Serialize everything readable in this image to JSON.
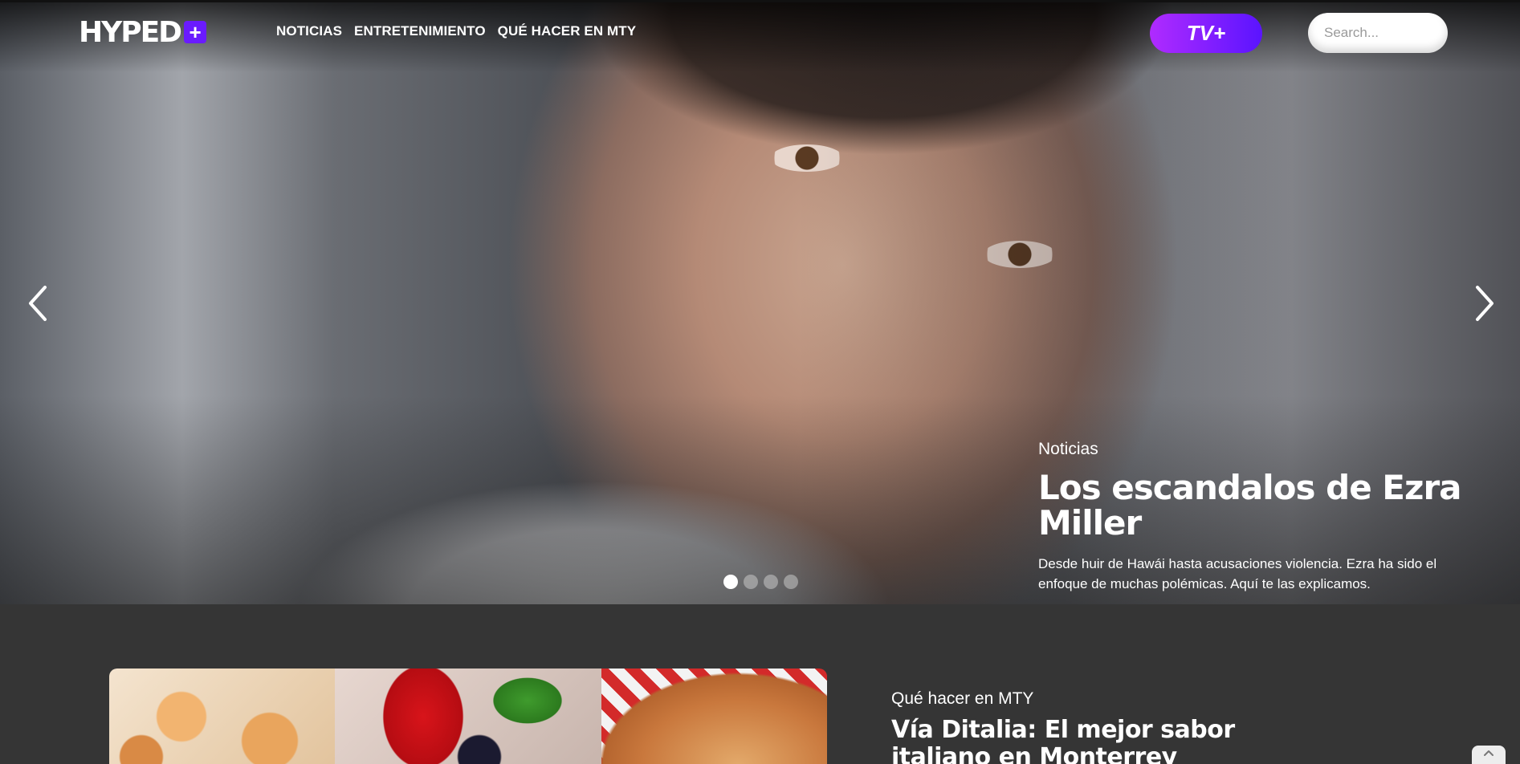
{
  "header": {
    "logo_text": "HYPED",
    "logo_plus": "+",
    "nav": [
      {
        "label": "NOTICIAS"
      },
      {
        "label": "ENTRETENIMIENTO"
      },
      {
        "label": "QUÉ HACER EN MTY"
      }
    ],
    "tv_button_label": "TV+",
    "search_placeholder": "Search..."
  },
  "carousel": {
    "category": "Noticias",
    "title": "Los escandalos de Ezra Miller",
    "description": "Desde huir de Hawái hasta acusaciones violencia. Ezra ha sido el enfoque de muchas polémicas. Aquí te las explicamos.",
    "slide_count": 4,
    "active_slide": 1,
    "prev_icon": "chevron-left-icon",
    "next_icon": "chevron-right-icon"
  },
  "featured": {
    "category": "Qué hacer en MTY",
    "title": "Vía Ditalia: El mejor sabor italiano en Monterrey"
  },
  "colors": {
    "accent_purple": "#5a14ff",
    "accent_magenta": "#b02bff",
    "section_bg": "#353535"
  }
}
